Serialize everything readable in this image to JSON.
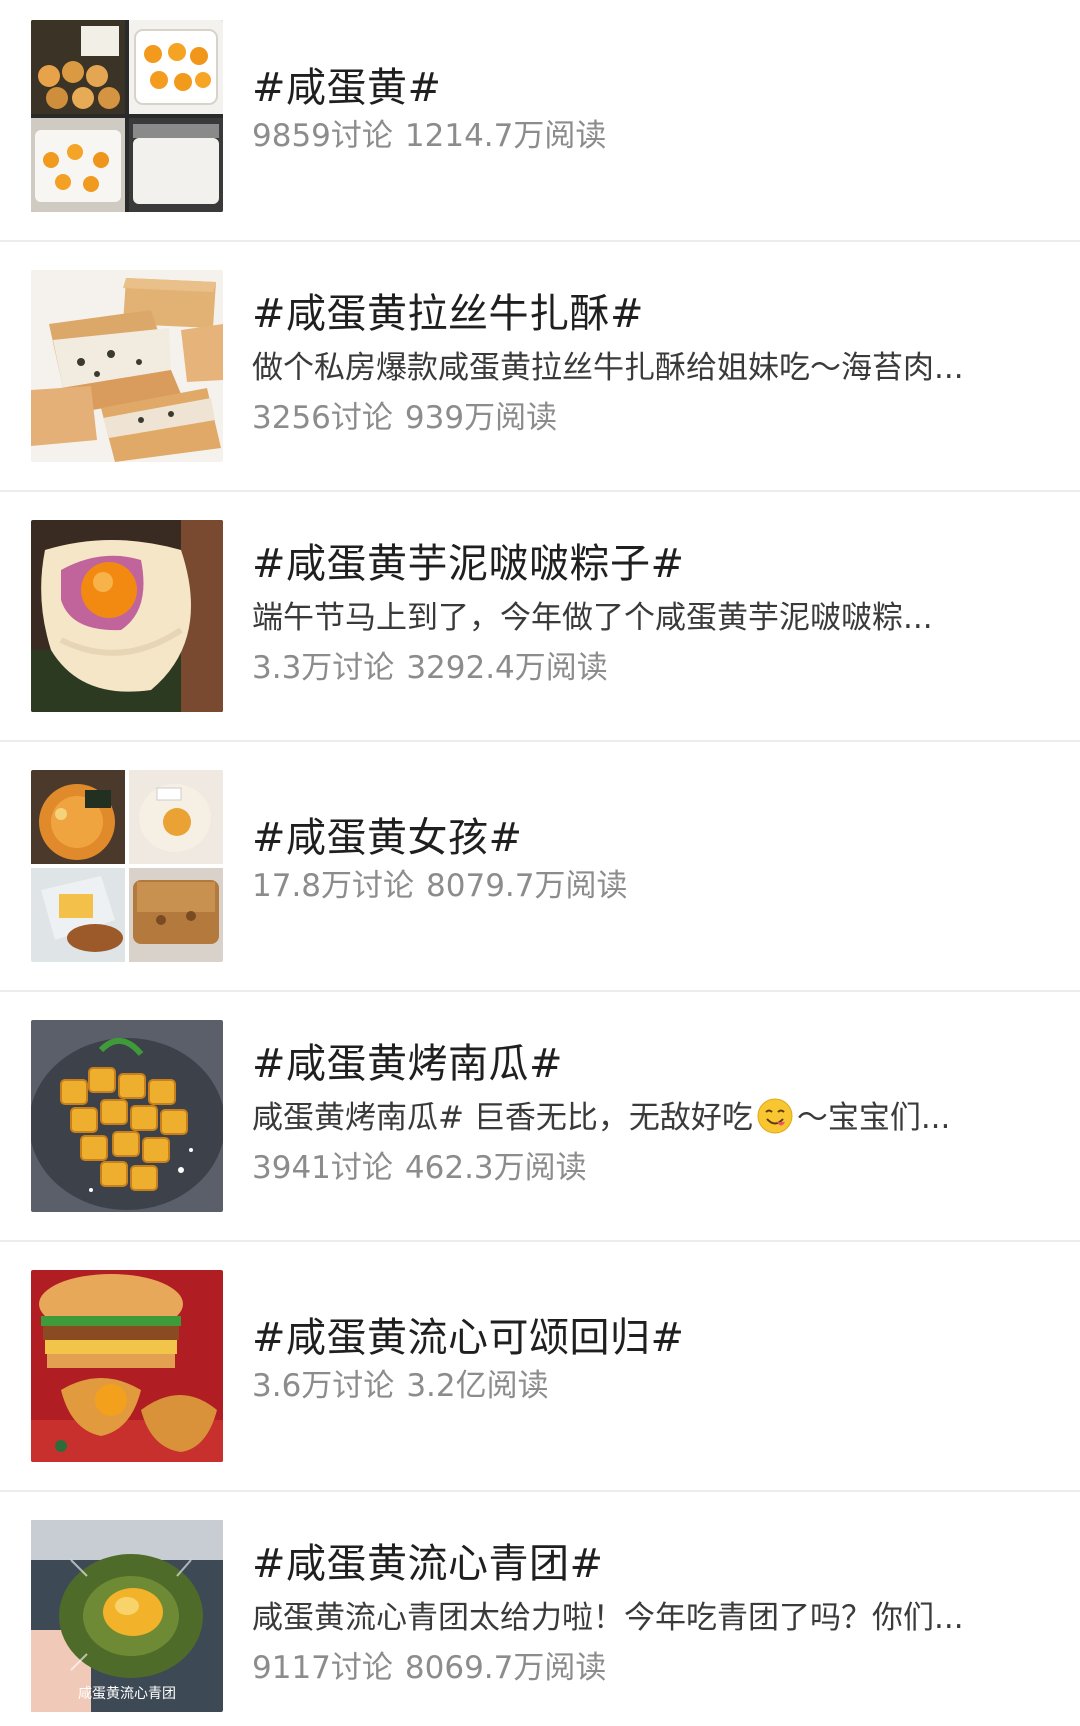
{
  "topics": [
    {
      "title": "#咸蛋黄#",
      "snippet": "",
      "discussions": "9859讨论",
      "reads": "1214.7万阅读",
      "thumbnail": "salted-egg-yolk-collage-icon"
    },
    {
      "title": "#咸蛋黄拉丝牛扎酥#",
      "snippet": "做个私房爆款咸蛋黄拉丝牛扎酥给姐妹吃～海苔肉...",
      "discussions": "3256讨论",
      "reads": "939万阅读",
      "thumbnail": "nougat-biscuit-icon"
    },
    {
      "title": "#咸蛋黄芋泥啵啵粽子#",
      "snippet": "端午节马上到了，今年做了个咸蛋黄芋泥啵啵粽...",
      "discussions": "3.3万讨论",
      "reads": "3292.4万阅读",
      "thumbnail": "taro-zongzi-icon"
    },
    {
      "title": "#咸蛋黄女孩#",
      "snippet": "",
      "discussions": "17.8万讨论",
      "reads": "8079.7万阅读",
      "thumbnail": "salted-egg-girl-collage-icon"
    },
    {
      "title": "#咸蛋黄烤南瓜#",
      "snippet_before": "咸蛋黄烤南瓜#   巨香无比，无敌好吃",
      "snippet_after": "～宝宝们...",
      "discussions": "3941讨论",
      "reads": "462.3万阅读",
      "thumbnail": "roasted-pumpkin-icon",
      "emoji": "yum-face-emoji"
    },
    {
      "title": "#咸蛋黄流心可颂回归#",
      "snippet": "",
      "discussions": "3.6万讨论",
      "reads": "3.2亿阅读",
      "thumbnail": "croissant-burger-icon"
    },
    {
      "title": "#咸蛋黄流心青团#",
      "snippet": "咸蛋黄流心青团太给力啦！今年吃青团了吗？你们...",
      "discussions": "9117讨论",
      "reads": "8069.7万阅读",
      "thumbnail": "green-rice-ball-icon",
      "image_caption": "咸蛋黄流心青团"
    }
  ],
  "colors": {
    "title": "#1f1f1f",
    "snippet": "#3a3a3a",
    "stats": "#8c8c8c",
    "divider": "#ececec",
    "background": "#ffffff"
  }
}
